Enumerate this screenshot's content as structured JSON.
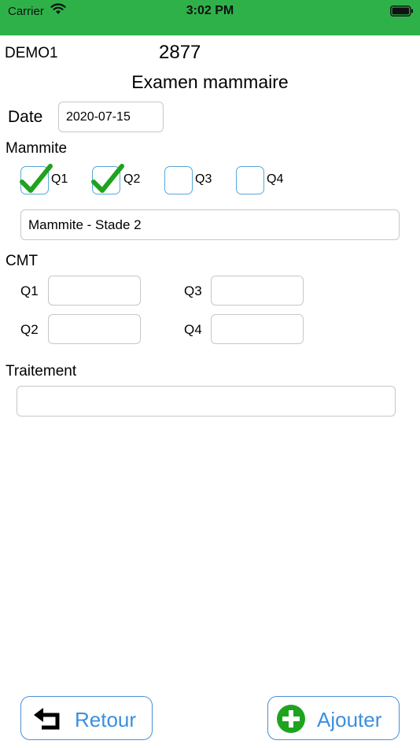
{
  "status_bar": {
    "carrier": "Carrier",
    "time": "3:02 PM",
    "wifi_icon": "wifi-icon",
    "battery_icon": "battery-icon",
    "background": "#2fb14a"
  },
  "header": {
    "id": "DEMO1",
    "number": "2877",
    "title": "Examen mammaire"
  },
  "date": {
    "label": "Date",
    "value": "2020-07-15"
  },
  "mammite": {
    "label": "Mammite",
    "quarters": [
      {
        "label": "Q1",
        "checked": true
      },
      {
        "label": "Q2",
        "checked": true
      },
      {
        "label": "Q3",
        "checked": false
      },
      {
        "label": "Q4",
        "checked": false
      }
    ],
    "stage_value": "Mammite - Stade 2",
    "check_color": "#1ea31e"
  },
  "cmt": {
    "label": "CMT",
    "fields": [
      {
        "label": "Q1",
        "value": ""
      },
      {
        "label": "Q3",
        "value": ""
      },
      {
        "label": "Q2",
        "value": ""
      },
      {
        "label": "Q4",
        "value": ""
      }
    ]
  },
  "traitement": {
    "label": "Traitement",
    "value": ""
  },
  "buttons": {
    "back_label": "Retour",
    "back_icon": "return-arrow-icon",
    "add_label": "Ajouter",
    "add_icon": "plus-circle-icon",
    "accent": "#3a8fe0"
  }
}
